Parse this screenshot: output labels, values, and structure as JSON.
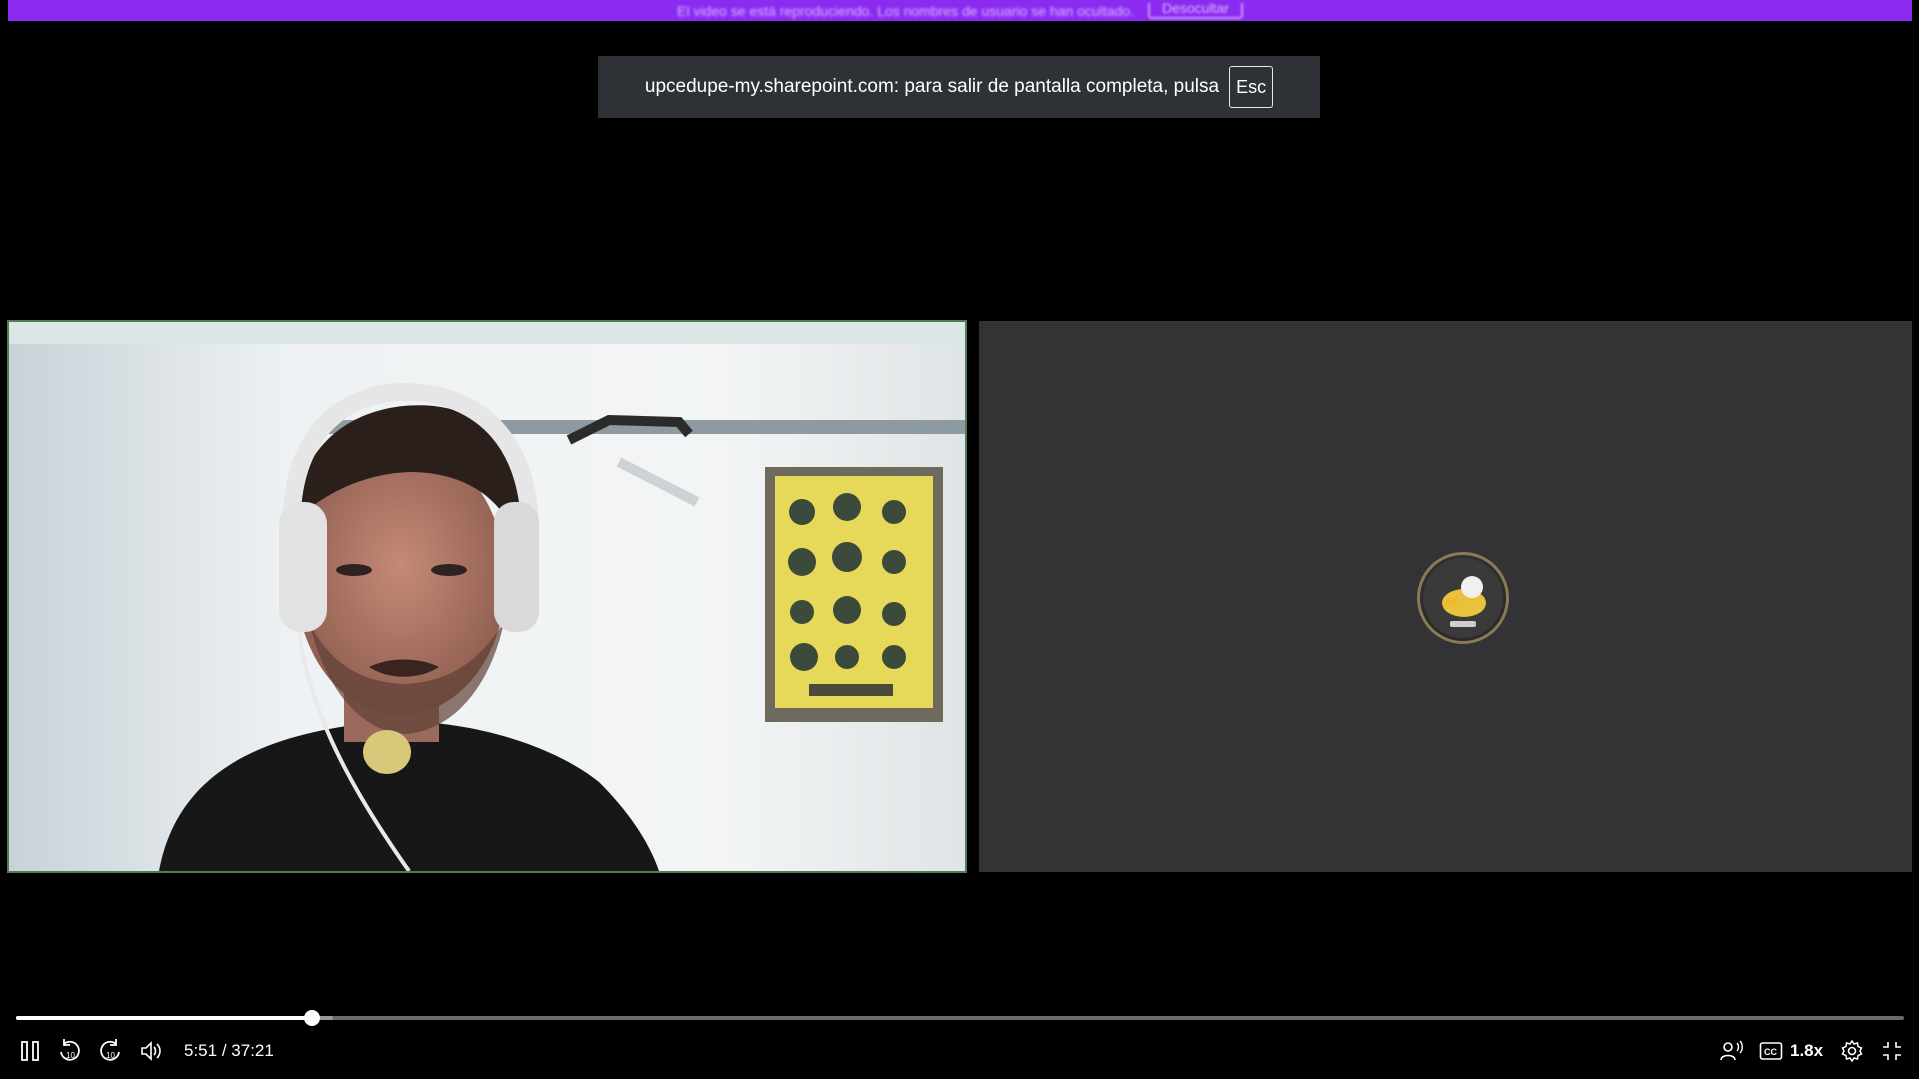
{
  "banner": {
    "text": "El video se está reproduciendo. Los nombres de usuario se han ocultado.",
    "button_label": "Desocultar"
  },
  "fullscreen_notice": {
    "text": "upcedupe-my.sharepoint.com: para salir de pantalla completa, pulsa",
    "key": "Esc"
  },
  "player": {
    "current_time": "5:51",
    "separator": "/",
    "duration": "37:21",
    "progress_fraction": 0.157,
    "buffered_fraction": 0.168,
    "speed": "1.8x",
    "colors": {
      "banner": "#8c2bf0",
      "notice_bg": "#2e3237",
      "tile_bg": "#333234",
      "speaker_border": "#4f7d58"
    },
    "icons": {
      "pause": "pause-icon",
      "rewind": "rewind-10-icon",
      "forward": "forward-10-icon",
      "volume": "volume-icon",
      "speaker_view": "speaker-view-icon",
      "captions": "captions-icon",
      "settings": "gear-icon",
      "exit_fullscreen": "exit-fullscreen-icon"
    },
    "skip_seconds": "10"
  }
}
